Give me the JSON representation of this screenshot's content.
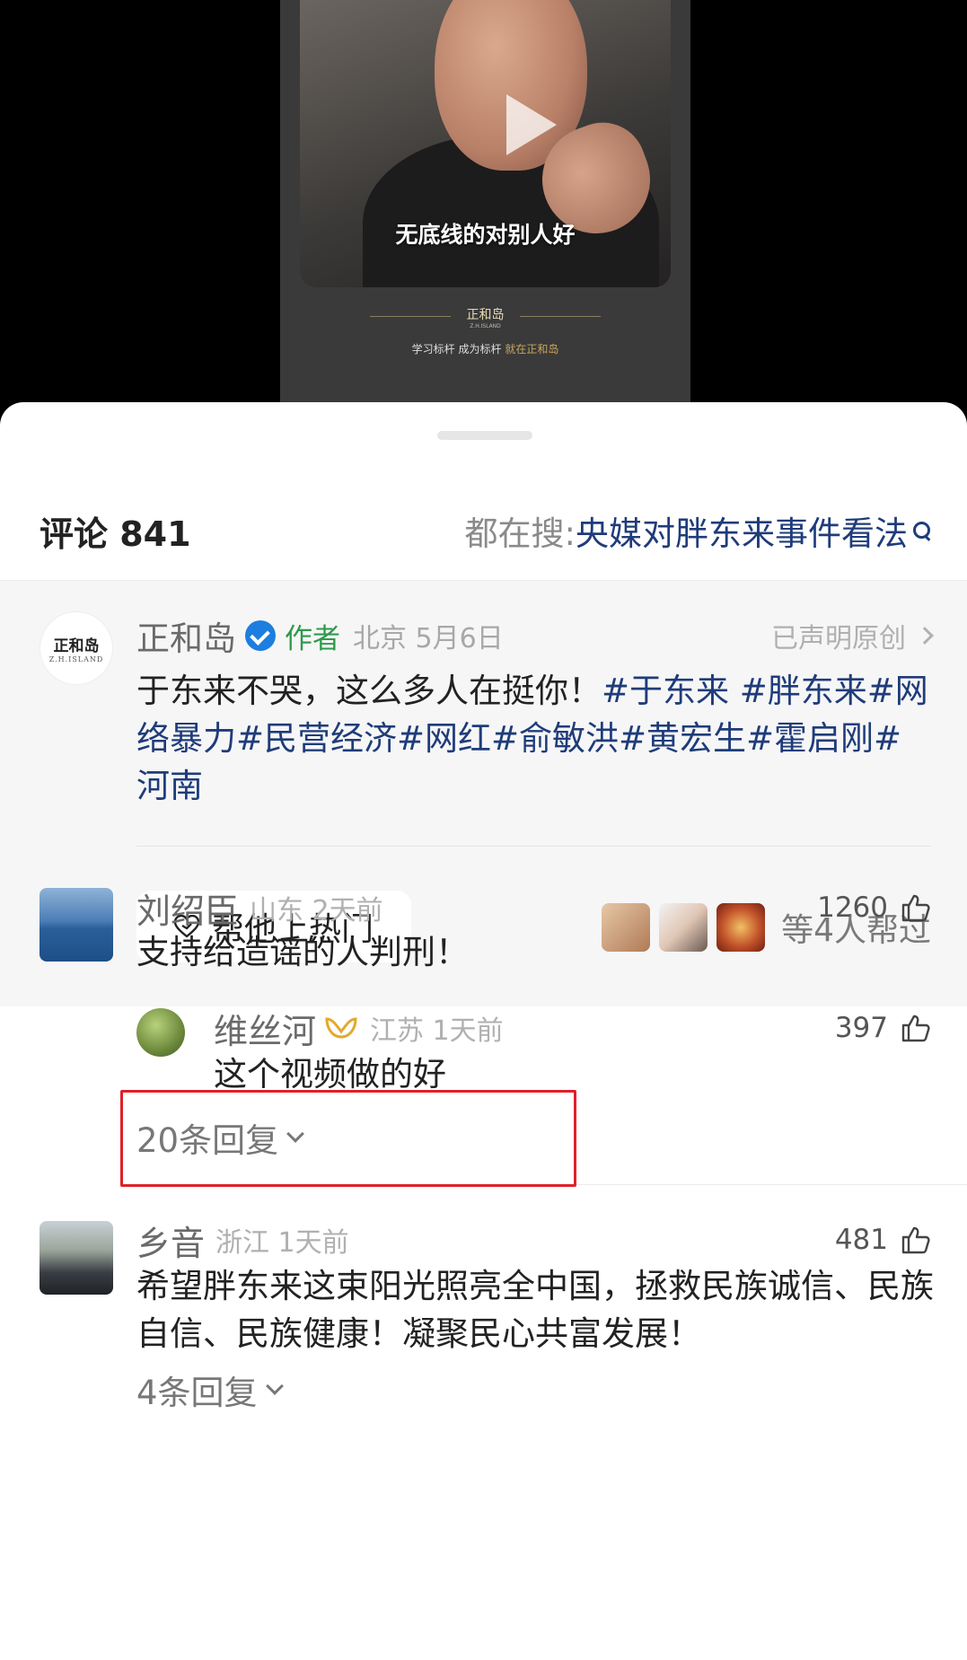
{
  "video": {
    "subtitle": "无底线的对别人好",
    "brand_logo": "正和岛",
    "brand_sub": "Z.H.ISLAND",
    "tagline_a": "学习标杆 成为标杆",
    "tagline_b": "就在正和岛"
  },
  "header": {
    "title": "评论 841",
    "trending_label": "都在搜:",
    "trending_query": "央媒对胖东来事件看法"
  },
  "author_post": {
    "avatar_logo": "正和岛",
    "avatar_sub": "Z.H.ISLAND",
    "name": "正和岛",
    "tag": "作者",
    "location_date": "北京 5月6日",
    "original": "已声明原创",
    "text_plain": "于东来不哭，这么多人在挺你！",
    "hashtags": "#于东来 #胖东来#网络暴力#民营经济#网红#俞敏洪#黄宏生#霍启刚#河南",
    "boost_label": "帮他上热门",
    "helpers_text": "等4人帮过"
  },
  "comments": [
    {
      "name": "刘绍臣",
      "location_time": "山东  2天前",
      "likes": "1260",
      "text": "支持给造谣的人判刑！",
      "reply": {
        "name": "维丝河",
        "location_time": "江苏  1天前",
        "likes": "397",
        "text": "这个视频做的好"
      },
      "more_replies": "20条回复"
    },
    {
      "name": "乡音",
      "location_time": "浙江  1天前",
      "likes": "481",
      "text": "希望胖东来这束阳光照亮全中国，拯救民族诚信、民族自信、民族健康！凝聚民心共富发展！",
      "more_replies": "4条回复"
    }
  ]
}
